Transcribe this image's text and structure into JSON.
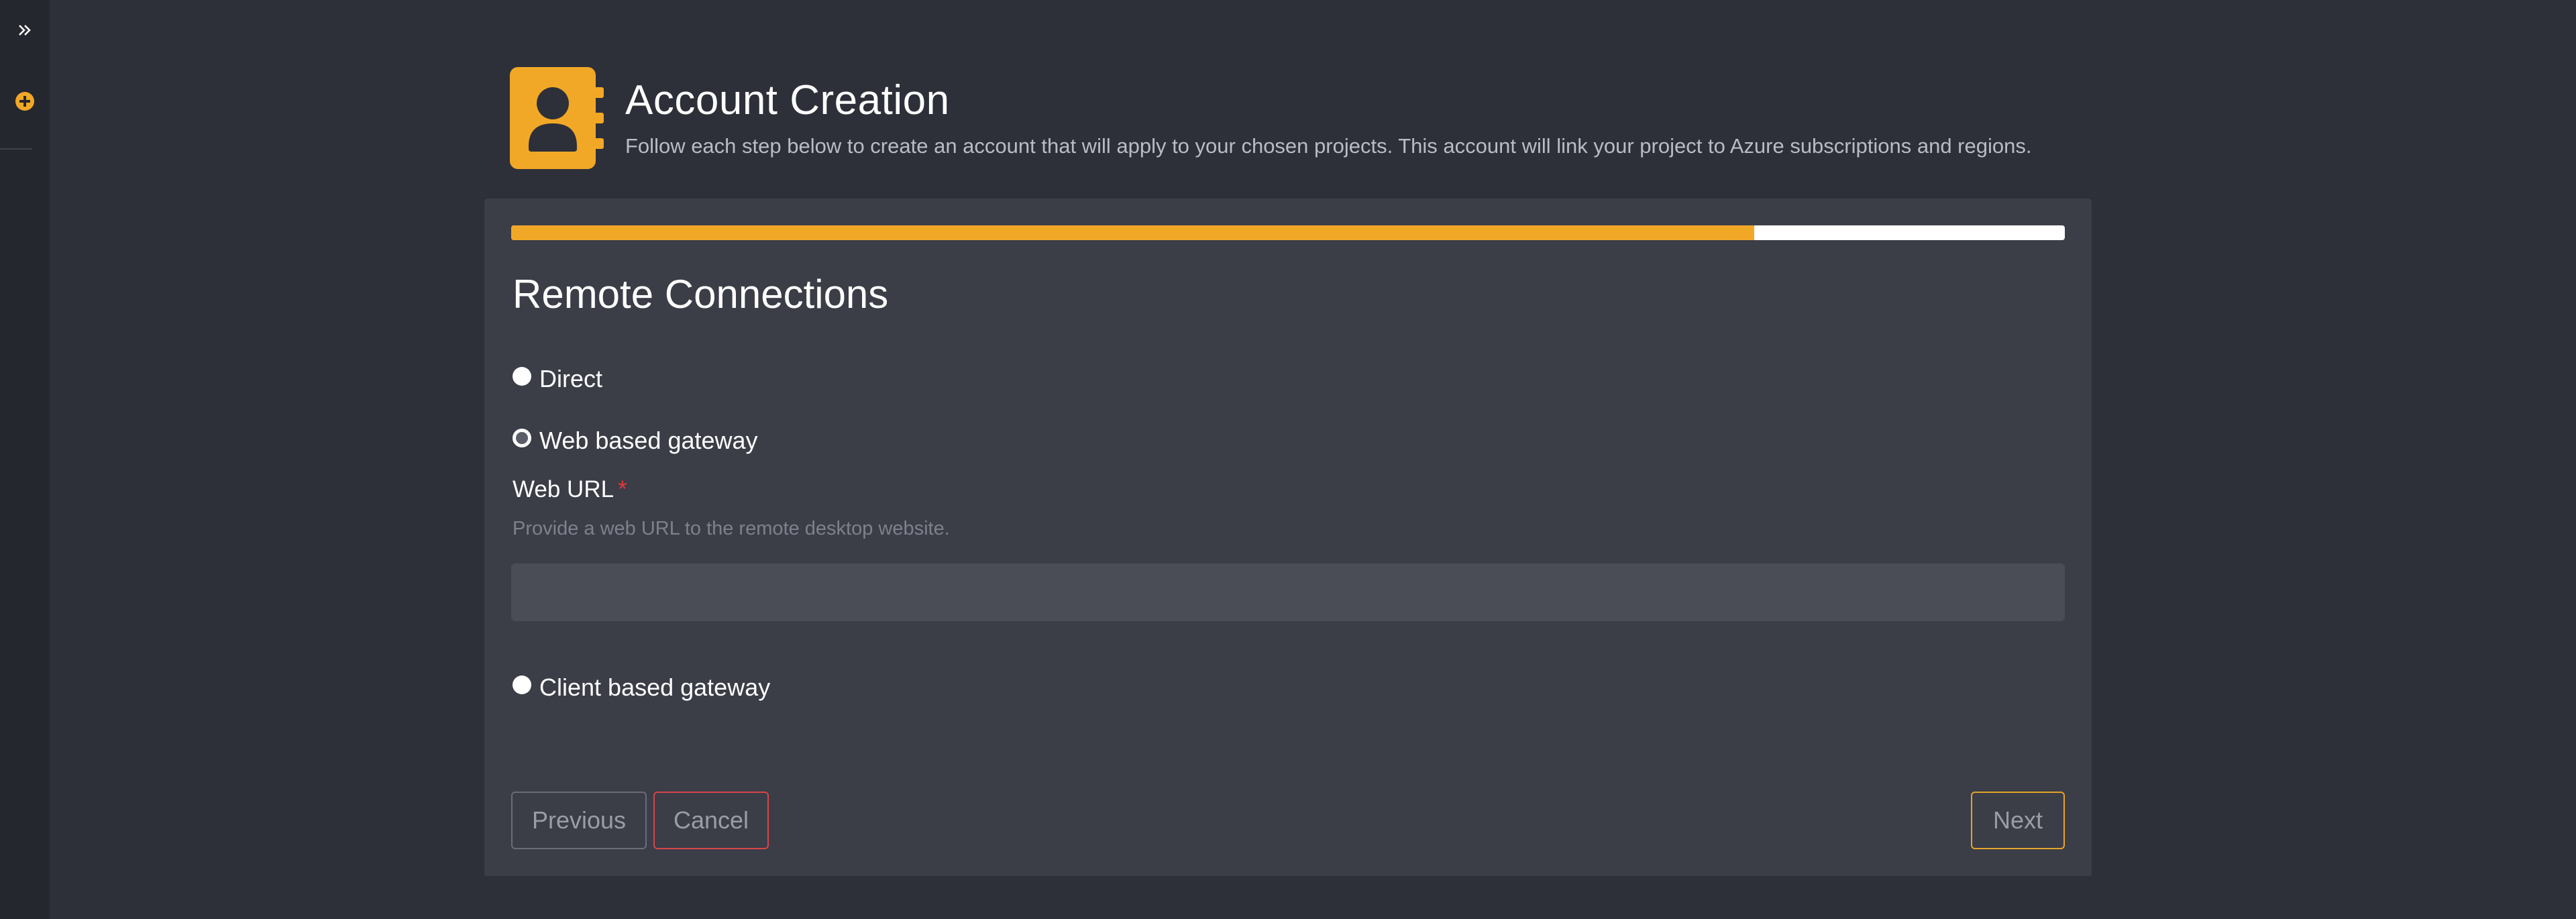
{
  "sidebar": {
    "expand_icon": "chevron-double-right-icon",
    "add_icon": "plus-circle-icon"
  },
  "header": {
    "icon": "contact-book-icon",
    "title": "Account Creation",
    "subtitle": "Follow each step below to create an account that will apply to your chosen projects. This account will link your project to Azure subscriptions and regions."
  },
  "wizard": {
    "progress_fraction": 0.8,
    "step_title": "Remote Connections",
    "options": [
      {
        "label": "Direct",
        "checked": false
      },
      {
        "label": "Web based gateway",
        "checked": true
      },
      {
        "label": "Client based gateway",
        "checked": false
      }
    ],
    "web_url": {
      "label": "Web URL",
      "required_mark": "*",
      "help": "Provide a web URL to the remote desktop website.",
      "value": ""
    },
    "buttons": {
      "previous": "Previous",
      "cancel": "Cancel",
      "next": "Next"
    }
  },
  "colors": {
    "accent": "#f2a827",
    "danger": "#d94548",
    "background": "#2e3039",
    "card": "#3b3d47",
    "sidebar": "#25272e"
  }
}
